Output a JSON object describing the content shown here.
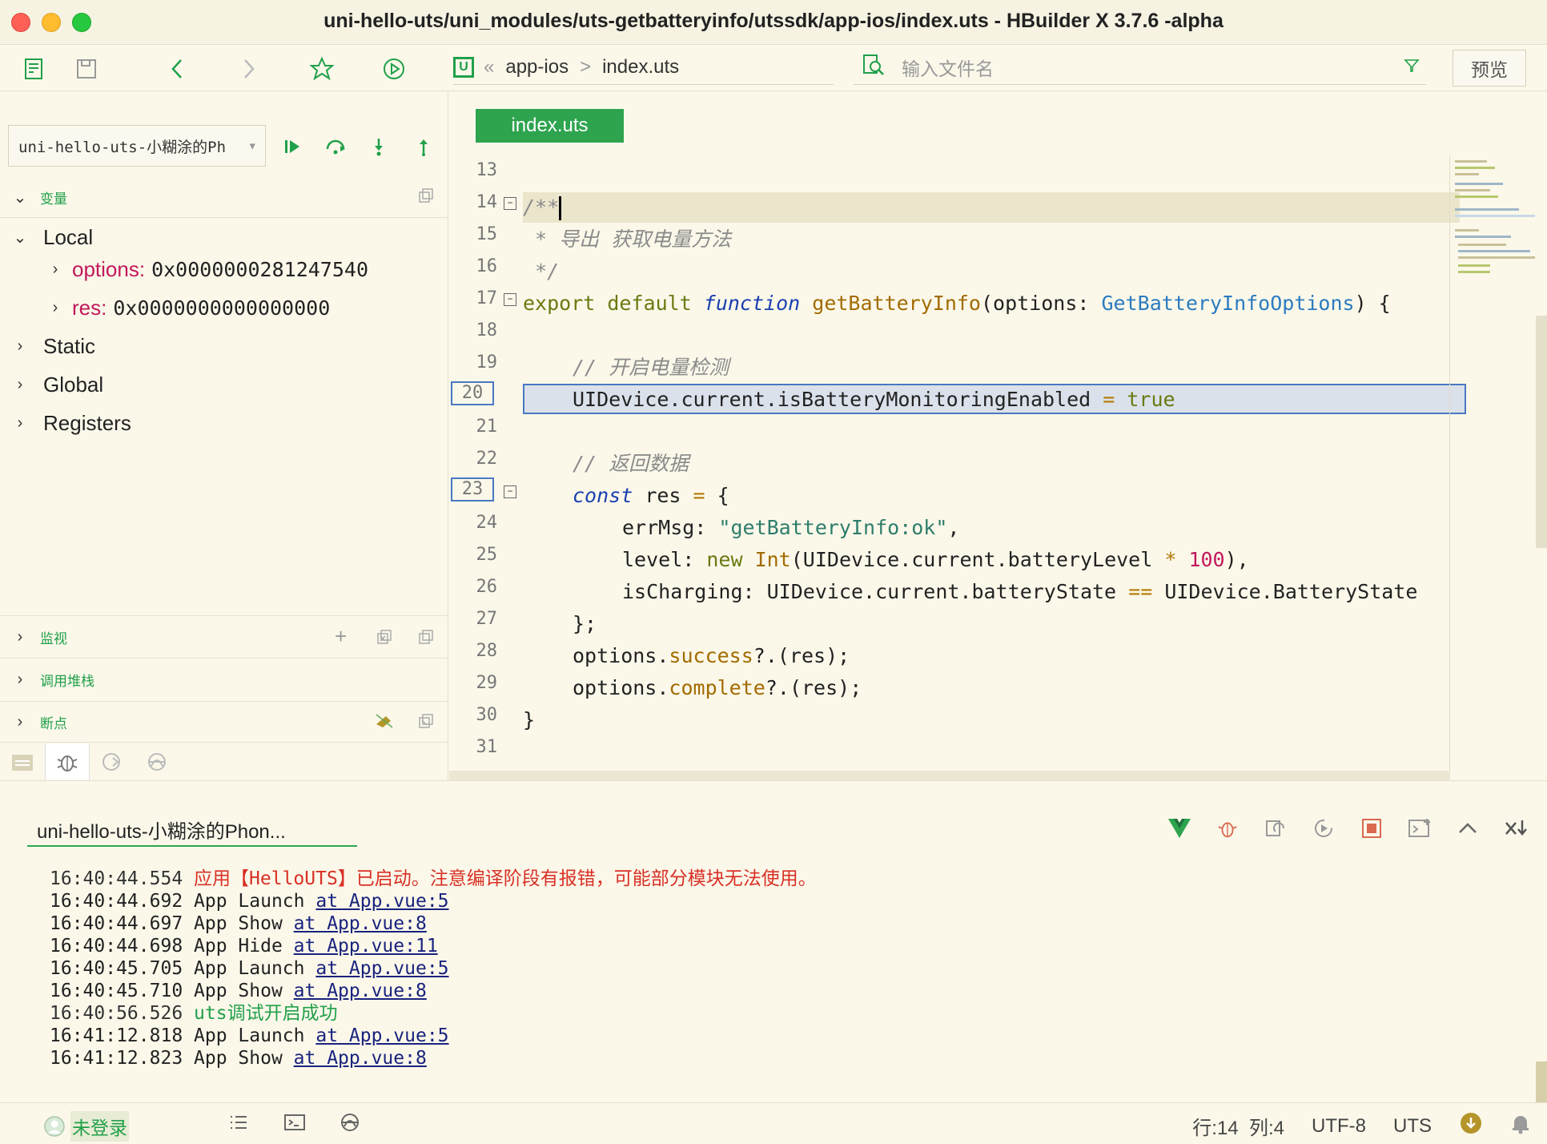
{
  "window": {
    "title": "uni-hello-uts/uni_modules/uts-getbatteryinfo/utssdk/app-ios/index.uts - HBuilder X 3.7.6 -alpha"
  },
  "toolbar": {
    "breadcrumb": {
      "badge": "U",
      "folder": "app-ios",
      "file": "index.uts",
      "back_sep": "«",
      "sep": ">"
    },
    "search_placeholder": "输入文件名",
    "preview_label": "预览"
  },
  "debug": {
    "target": "uni-hello-uts-小糊涂的Ph",
    "sections": {
      "variables": "变量",
      "watch": "监视",
      "callstack": "调用堆栈",
      "breakpoints": "断点"
    },
    "scopes": {
      "local": "Local",
      "static": "Static",
      "global": "Global",
      "registers": "Registers"
    },
    "locals": [
      {
        "name": "options:",
        "value": "0x0000000281247540"
      },
      {
        "name": "res:",
        "value": "0x0000000000000000"
      }
    ]
  },
  "editor": {
    "tab": "index.uts",
    "line_numbers": [
      "13",
      "14",
      "15",
      "16",
      "17",
      "18",
      "19",
      "20",
      "21",
      "22",
      "23",
      "24",
      "25",
      "26",
      "27",
      "28",
      "29",
      "30",
      "31"
    ],
    "code": {
      "l14": "/**",
      "l15": " * 导出 获取电量方法",
      "l16": " */",
      "l17_kw": "export default",
      "l17_fn": "function",
      "l17_name": "getBatteryInfo",
      "l17_p1": "(options: ",
      "l17_type": "GetBatteryInfoOptions",
      "l17_p2": ") {",
      "l19": "// 开启电量检测",
      "l20_a": "UIDevice.current.isBatteryMonitoringEnabled",
      "l20_op": " = ",
      "l20_val": "true",
      "l22": "// 返回数据",
      "l23_kw": "const",
      "l23_rest": " res ",
      "l23_op": "=",
      "l23_brace": " {",
      "l24_key": "errMsg: ",
      "l24_str": "\"getBatteryInfo:ok\"",
      "l24_end": ",",
      "l25_key": "level: ",
      "l25_new": "new",
      "l25_int": " Int",
      "l25_mid": "(UIDevice.current.batteryLevel ",
      "l25_op": "*",
      "l25_num": " 100",
      "l25_end": "),",
      "l26_key": "isCharging: UIDevice.current.batteryState ",
      "l26_op": "==",
      "l26_end": " UIDevice.BatteryState",
      "l27": "};",
      "l28_a": "options.",
      "l28_m": "success",
      "l28_b": "?.(res);",
      "l29_a": "options.",
      "l29_m": "complete",
      "l29_b": "?.(res);",
      "l30": "}"
    }
  },
  "console": {
    "tab": "uni-hello-uts-小糊涂的Phon...",
    "logs": [
      {
        "time": "16:40:44.554",
        "text": "应用【HelloUTS】已启动。注意编译阶段有报错，可能部分模块无法使用。",
        "link": "",
        "kind": "err"
      },
      {
        "time": "16:40:44.692",
        "text": "App Launch ",
        "link": "at App.vue:5",
        "kind": "normal"
      },
      {
        "time": "16:40:44.697",
        "text": "App Show ",
        "link": "at App.vue:8",
        "kind": "normal"
      },
      {
        "time": "16:40:44.698",
        "text": "App Hide ",
        "link": "at App.vue:11",
        "kind": "normal"
      },
      {
        "time": "16:40:45.705",
        "text": "App Launch ",
        "link": "at App.vue:5",
        "kind": "normal"
      },
      {
        "time": "16:40:45.710",
        "text": "App Show ",
        "link": "at App.vue:8",
        "kind": "normal"
      },
      {
        "time": "16:40:56.526",
        "text": "uts调试开启成功",
        "link": "",
        "kind": "ok"
      },
      {
        "time": "16:41:12.818",
        "text": "App Launch ",
        "link": "at App.vue:5",
        "kind": "normal"
      },
      {
        "time": "16:41:12.823",
        "text": "App Show ",
        "link": "at App.vue:8",
        "kind": "normal"
      }
    ]
  },
  "status": {
    "login": "未登录",
    "position": "行:14  列:4",
    "encoding": "UTF-8",
    "language": "UTS"
  },
  "colors": {
    "accent": "#2ea44f",
    "background": "#fbf8ea",
    "error": "#d93025",
    "breakpoint": "#4a78c2"
  }
}
